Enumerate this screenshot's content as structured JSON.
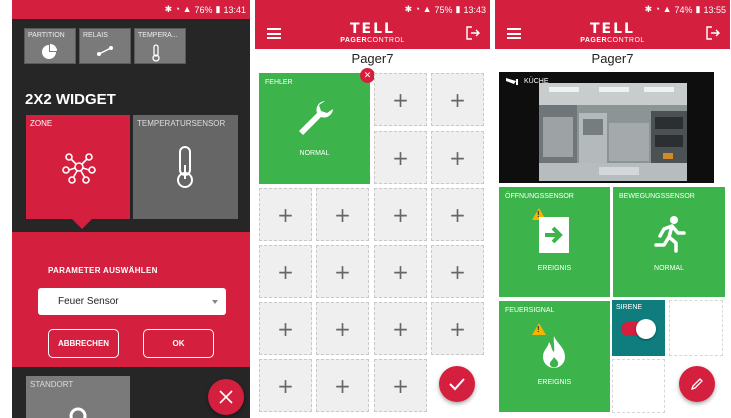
{
  "phone1": {
    "status": {
      "signal": "76%",
      "time": "13:41"
    },
    "mini_tiles": [
      {
        "label": "PARTITION",
        "icon": "pie-chart-icon"
      },
      {
        "label": "RELAIS",
        "icon": "relay-icon"
      },
      {
        "label": "TEMPERA...",
        "icon": "thermometer-icon"
      }
    ],
    "widget_title": "2X2 WIDGET",
    "zone_label": "ZONE",
    "temp_label": "TEMPERATURSENSOR",
    "dialog": {
      "title": "PARAMETER AUSWÄHLEN",
      "select_value": "Feuer Sensor",
      "cancel_label": "ABBRECHEN",
      "ok_label": "OK"
    },
    "standort_label": "STANDORT",
    "fab_icon": "close-icon"
  },
  "phone2": {
    "status": {
      "signal": "75%",
      "time": "13:43"
    },
    "logo": {
      "main": "TELL",
      "sub_bold": "PAGER",
      "sub": "CONTROL"
    },
    "title": "Pager7",
    "tile": {
      "label": "FEHLER",
      "status": "NORMAL",
      "icon": "wrench-icon"
    },
    "plus": "+",
    "fab_icon": "check-icon"
  },
  "phone3": {
    "status": {
      "signal": "74%",
      "time": "13:55"
    },
    "logo": {
      "main": "TELL",
      "sub_bold": "PAGER",
      "sub": "CONTROL"
    },
    "title": "Pager7",
    "camera": {
      "label": "KÜCHE",
      "icon": "camera-icon"
    },
    "tiles": [
      {
        "label": "ÖFFNUNGSSENSOR",
        "status": "EREIGNIS",
        "icon": "door-exit-icon",
        "warning": true
      },
      {
        "label": "BEWEGUNGSSENSOR",
        "status": "NORMAL",
        "icon": "running-person-icon",
        "warning": false
      },
      {
        "label": "FEUERSIGNAL",
        "status": "EREIGNIS",
        "icon": "flame-icon",
        "warning": true
      }
    ],
    "sirene": {
      "label": "SIRENE",
      "state": "on"
    },
    "fab_icon": "edit-icon"
  },
  "colors": {
    "brand_red": "#d41f3f",
    "green": "#3cb44b",
    "teal": "#0f7d7d",
    "warning": "#f4b400"
  }
}
